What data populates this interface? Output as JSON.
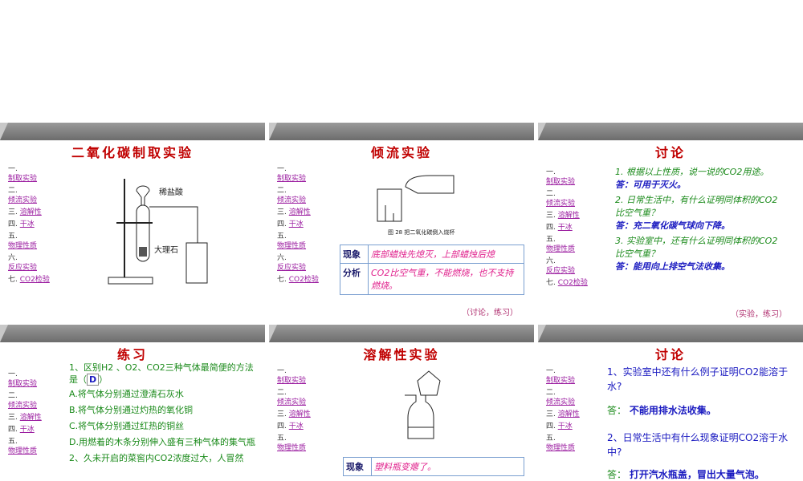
{
  "nav": [
    {
      "num": "一.",
      "label": "制取实验"
    },
    {
      "num": "二.",
      "label": "倾流实验"
    },
    {
      "num": "三.",
      "label": "溶解性"
    },
    {
      "num": "四.",
      "label": "干冰"
    },
    {
      "num": "五.",
      "label": "物理性质"
    },
    {
      "num": "六.",
      "label": "反应实验"
    },
    {
      "num": "七.",
      "label": "CO2检验"
    }
  ],
  "slide1": {
    "title": "二氧化碳制取实验",
    "label_acid": "稀盐酸",
    "label_stone": "大理石"
  },
  "slide2": {
    "title": "倾流实验",
    "fig_caption": "图 28  把二氧化碳倒入烧杯",
    "rows": [
      {
        "k": "现象",
        "v": "底部蜡烛先熄灭，上部蜡烛后熄"
      },
      {
        "k": "分析",
        "v": "CO2比空气重，不能燃烧，也不支持燃烧。"
      }
    ],
    "note": "（讨论，练习）"
  },
  "slide3": {
    "title": "讨论",
    "q1": "1. 根据以上性质，说一说的CO2用途。",
    "a1": "答：可用于灭火。",
    "q2": "2. 日常生活中，有什么证明同体积的CO2比空气重？",
    "a2": "答：充二氧化碳气球向下降。",
    "q3": "3. 实验室中，还有什么证明同体积的CO2比空气重？",
    "a3": "答：能用向上排空气法收集。",
    "note": "（实验，练习）"
  },
  "slide4": {
    "title": "练习",
    "q": "1、区别H2 、O2、CO2三种气体最简便的方法是（",
    "ans": "D",
    "q_end": "）",
    "opts": [
      "A.将气体分别通过澄清石灰水",
      "B.将气体分别通过灼热的氧化铜",
      "C.将气体分别通过红热的铜丝",
      "D.用燃着的木条分别伸入盛有三种气体的集气瓶"
    ],
    "q2": "2、久未开启的菜窖内CO2浓度过大，人冒然"
  },
  "slide5": {
    "title": "溶解性实验",
    "row_k": "现象",
    "row_v": "塑料瓶变瘪了。"
  },
  "slide6": {
    "title": "讨论",
    "q1": "1、实验室中还有什么例子证明CO2能溶于水?",
    "a1_k": "答：",
    "a1": "不能用排水法收集。",
    "q2": "2、日常生活中有什么现象证明CO2溶于水中?",
    "a2_k": "答：",
    "a2": "打开汽水瓶盖，冒出大量气泡。"
  }
}
